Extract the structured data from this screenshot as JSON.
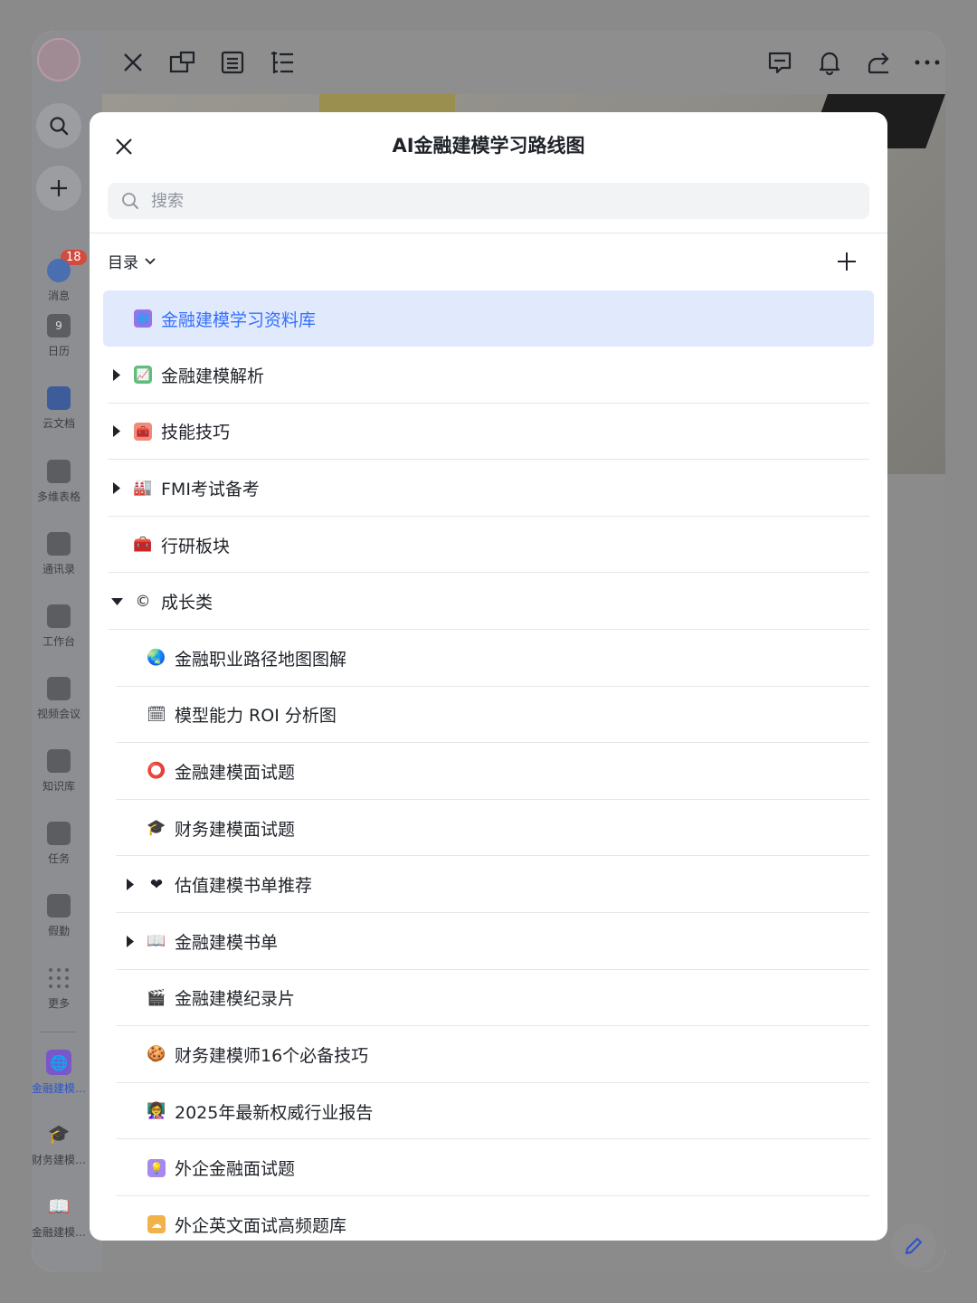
{
  "rail": {
    "badge_count": "18",
    "items": [
      {
        "label": "消息",
        "icon": "chat-icon"
      },
      {
        "label": "日历",
        "icon": "calendar-icon",
        "glyph": "9"
      },
      {
        "label": "云文档",
        "icon": "doc-icon"
      },
      {
        "label": "多维表格",
        "icon": "base-icon"
      },
      {
        "label": "通讯录",
        "icon": "contacts-icon"
      },
      {
        "label": "工作台",
        "icon": "apps-icon"
      },
      {
        "label": "视频会议",
        "icon": "video-icon"
      },
      {
        "label": "知识库",
        "icon": "wiki-icon"
      },
      {
        "label": "任务",
        "icon": "task-icon"
      },
      {
        "label": "假勤",
        "icon": "attendance-icon"
      },
      {
        "label": "更多",
        "icon": "more-icon"
      }
    ],
    "pinned": [
      {
        "label": "金融建模…",
        "icon": "globe-icon",
        "emoji": "🌐"
      },
      {
        "label": "财务建模…",
        "icon": "graduation-cap-icon",
        "emoji": "🎓"
      },
      {
        "label": "金融建模…",
        "icon": "book-icon",
        "emoji": "📖"
      }
    ]
  },
  "modal": {
    "title": "AI金融建模学习路线图",
    "search_placeholder": "搜索",
    "toc_label": "目录"
  },
  "tree": [
    {
      "label": "金融建模学习资料库",
      "emoji": "🌐",
      "level": 0,
      "expand": "none",
      "selected": true
    },
    {
      "label": "金融建模解析",
      "emoji": "📈",
      "level": 0,
      "expand": "collapsed"
    },
    {
      "label": "技能技巧",
      "emoji": "🧰",
      "level": 0,
      "expand": "collapsed"
    },
    {
      "label": "FMI考试备考",
      "emoji": "🏭",
      "level": 0,
      "expand": "collapsed"
    },
    {
      "label": "行研板块",
      "emoji": "🧰",
      "level": 0,
      "expand": "none"
    },
    {
      "label": "成长类",
      "emoji": "©",
      "level": 0,
      "expand": "expanded"
    },
    {
      "label": "金融职业路径地图图解",
      "emoji": "🌏",
      "level": 1,
      "expand": "none"
    },
    {
      "label": "模型能力 ROI 分析图",
      "emoji": "🗓",
      "level": 1,
      "expand": "none"
    },
    {
      "label": "金融建模面试题",
      "emoji": "⭕",
      "level": 1,
      "expand": "none"
    },
    {
      "label": "财务建模面试题",
      "emoji": "🎓",
      "level": 1,
      "expand": "none"
    },
    {
      "label": "估值建模书单推荐",
      "emoji": "❤",
      "level": 1,
      "expand": "collapsed"
    },
    {
      "label": "金融建模书单",
      "emoji": "📖",
      "level": 1,
      "expand": "collapsed"
    },
    {
      "label": "金融建模纪录片",
      "emoji": "🎬",
      "level": 1,
      "expand": "none"
    },
    {
      "label": "财务建模师16个必备技巧",
      "emoji": "🍪",
      "level": 1,
      "expand": "none"
    },
    {
      "label": "2025年最新权威行业报告",
      "emoji": "👩‍🏫",
      "level": 1,
      "expand": "none"
    },
    {
      "label": "外企金融面试题",
      "emoji": "💡",
      "level": 1,
      "expand": "none"
    },
    {
      "label": "外企英文面试高频题库",
      "emoji": "☁",
      "level": 1,
      "expand": "none"
    }
  ],
  "colors": {
    "accent": "#3370ff",
    "selected_bg": "#e1e9fd",
    "badge": "#d34a3f"
  }
}
